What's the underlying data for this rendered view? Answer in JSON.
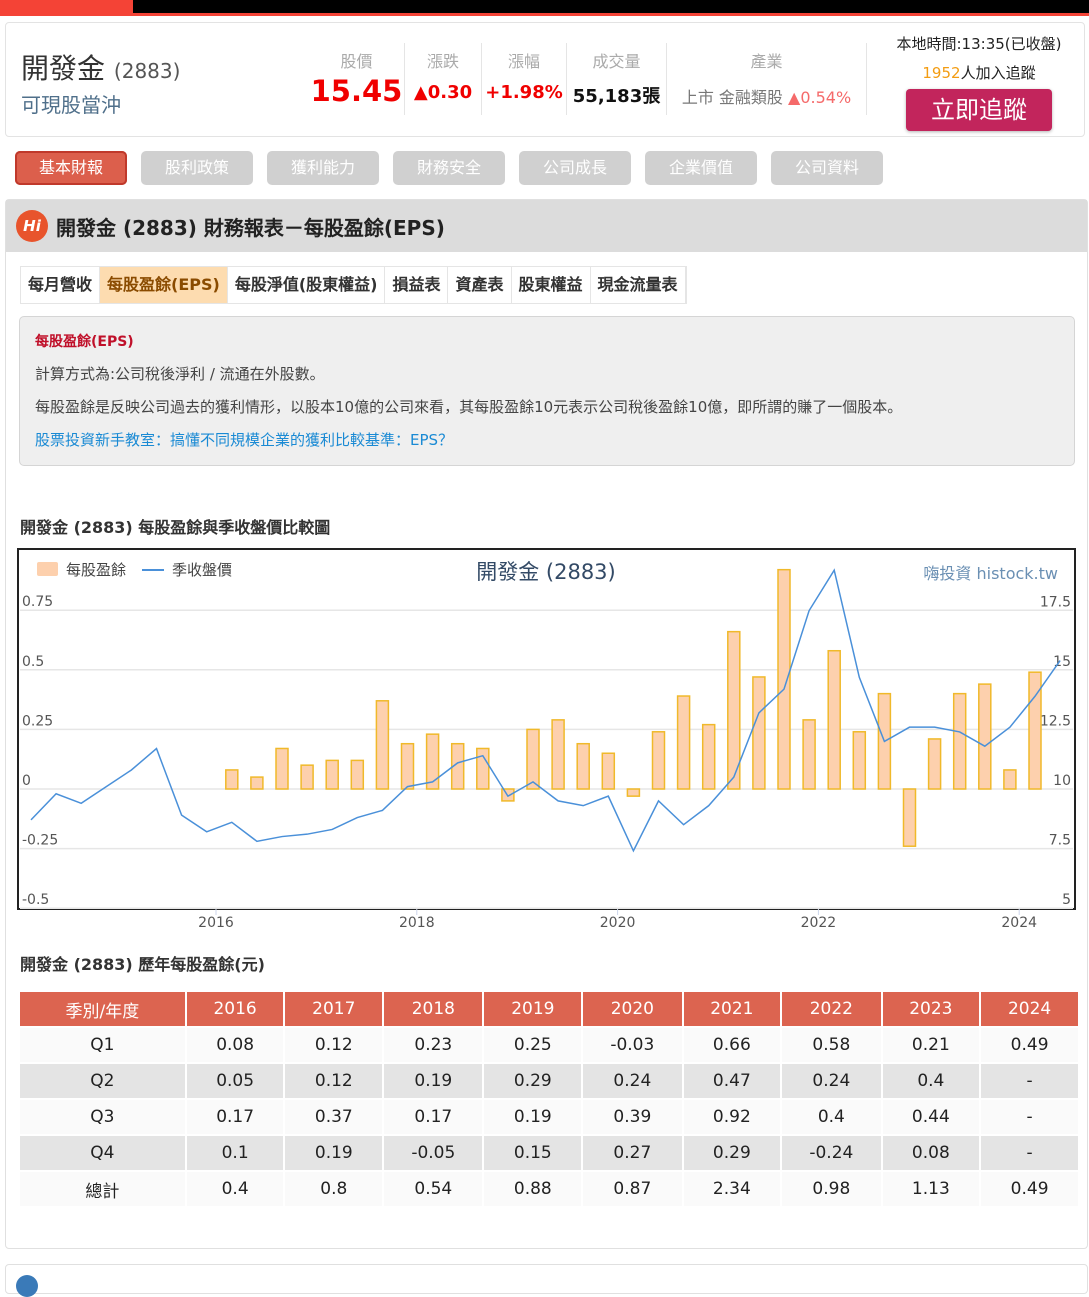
{
  "stock": {
    "name": "開發金",
    "code": "(2883)",
    "tag": "可現股當沖"
  },
  "quote": [
    {
      "label": "股價",
      "value": "15.45",
      "color": "#f00000"
    },
    {
      "label": "漲跌",
      "value": "▲0.30",
      "color": "#f00000"
    },
    {
      "label": "漲幅",
      "value": "+1.98%",
      "color": "#f00000"
    },
    {
      "label": "成交量",
      "value": "55,183張",
      "color": "#111111"
    }
  ],
  "industry": {
    "label": "產業",
    "market": "上市",
    "sector": "金融類股",
    "change": "▲0.54%"
  },
  "status": {
    "time": "本地時間:13:35(已收盤)",
    "followers": "1952",
    "followers_suffix": "人加入追蹤",
    "track_button": "立即追蹤"
  },
  "nav_tabs": [
    "基本財報",
    "股利政策",
    "獲利能力",
    "財務安全",
    "公司成長",
    "企業價值",
    "公司資料"
  ],
  "panel_title": "開發金 (2883) 財務報表－每股盈餘(EPS)",
  "sub_tabs": [
    "每月營收",
    "每股盈餘(EPS)",
    "每股淨值(股東權益)",
    "損益表",
    "資產表",
    "股東權益",
    "現金流量表"
  ],
  "info": {
    "heading": "每股盈餘(EPS)",
    "formula": "計算方式為:公司稅後淨利 / 流通在外股數。",
    "desc": "每股盈餘是反映公司過去的獲利情形，以股本10億的公司來看，其每股盈餘10元表示公司稅後盈餘10億，即所謂的賺了一個股本。",
    "link": "股票投資新手教室：搞懂不同規模企業的獲利比較基準：EPS？"
  },
  "chart_section_title": "開發金 (2883) 每股盈餘與季收盤價比較圖",
  "chart_data": {
    "type": "bar",
    "title": "開發金 (2883)",
    "watermark": "嗨投資 histock.tw",
    "legend": [
      "每股盈餘",
      "季收盤價"
    ],
    "legend_position": "top-left",
    "x_ticks": [
      "2016",
      "2018",
      "2020",
      "2022",
      "2024"
    ],
    "y_left_ticks": [
      "0.75",
      "0.5",
      "0.25",
      "0",
      "-0.25",
      "-0.5"
    ],
    "y_right_ticks": [
      "17.5",
      "15",
      "12.5",
      "10",
      "7.5",
      "5"
    ],
    "ylim_left": [
      -0.5,
      0.75
    ],
    "ylim_right": [
      5,
      17.5
    ],
    "eps_start": "2016Q1",
    "eps": [
      0.08,
      0.05,
      0.17,
      0.1,
      0.12,
      0.12,
      0.37,
      0.19,
      0.23,
      0.19,
      0.17,
      -0.05,
      0.25,
      0.29,
      0.19,
      0.15,
      -0.03,
      0.24,
      0.39,
      0.27,
      0.66,
      0.47,
      0.92,
      0.29,
      0.58,
      0.24,
      0.4,
      -0.24,
      0.21,
      0.4,
      0.44,
      0.08,
      0.49
    ],
    "price_start": "2014Q1",
    "price": [
      8.7,
      9.8,
      9.4,
      10.1,
      10.8,
      11.7,
      8.9,
      8.2,
      8.6,
      7.8,
      8.0,
      8.1,
      8.3,
      8.8,
      9.1,
      10.1,
      10.3,
      11.1,
      11.4,
      9.7,
      10.3,
      9.5,
      9.3,
      9.7,
      7.4,
      9.5,
      8.5,
      9.3,
      10.5,
      13.2,
      14.2,
      17.5,
      19.2,
      14.7,
      12.0,
      12.6,
      12.6,
      12.4,
      11.8,
      12.6,
      13.9,
      15.4
    ],
    "colors": {
      "bar_fill": "#fdd0ad",
      "bar_stroke": "#f0b92a",
      "line": "#4a90d9"
    }
  },
  "table_title": "開發金 (2883) 歷年每股盈餘(元)",
  "table": {
    "headers": [
      "季別/年度",
      "2016",
      "2017",
      "2018",
      "2019",
      "2020",
      "2021",
      "2022",
      "2023",
      "2024"
    ],
    "rows": [
      [
        "Q1",
        "0.08",
        "0.12",
        "0.23",
        "0.25",
        "-0.03",
        "0.66",
        "0.58",
        "0.21",
        "0.49"
      ],
      [
        "Q2",
        "0.05",
        "0.12",
        "0.19",
        "0.29",
        "0.24",
        "0.47",
        "0.24",
        "0.4",
        "-"
      ],
      [
        "Q3",
        "0.17",
        "0.37",
        "0.17",
        "0.19",
        "0.39",
        "0.92",
        "0.4",
        "0.44",
        "-"
      ],
      [
        "Q4",
        "0.1",
        "0.19",
        "-0.05",
        "0.15",
        "0.27",
        "0.29",
        "-0.24",
        "0.08",
        "-"
      ],
      [
        "總計",
        "0.4",
        "0.8",
        "0.54",
        "0.88",
        "0.87",
        "2.34",
        "0.98",
        "1.13",
        "0.49"
      ]
    ]
  }
}
